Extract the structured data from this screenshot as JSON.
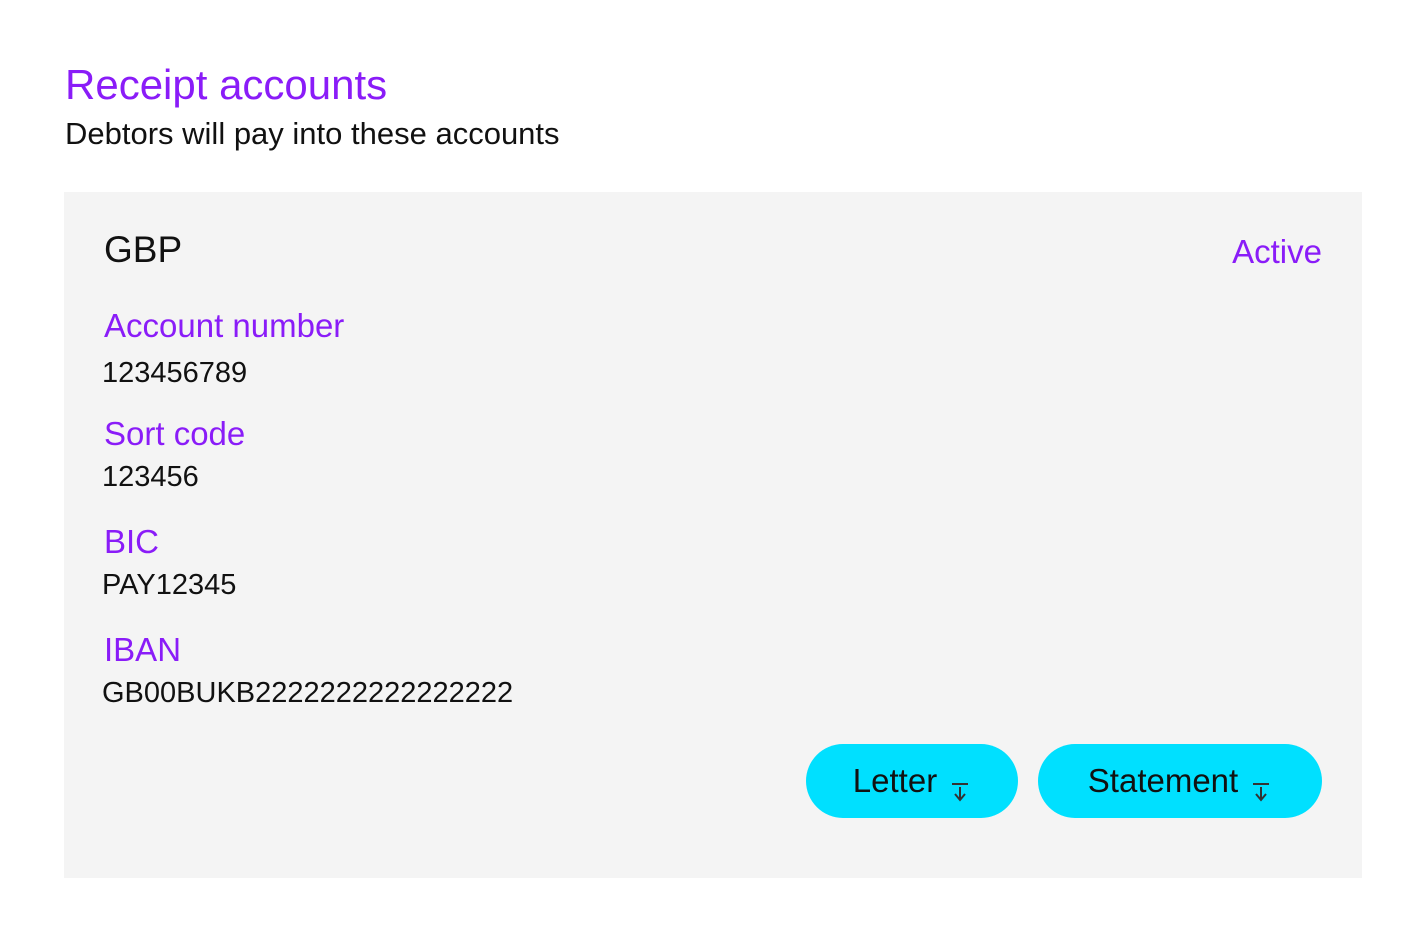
{
  "header": {
    "title": "Receipt accounts",
    "subtitle": "Debtors will pay into these accounts"
  },
  "account": {
    "currency": "GBP",
    "status": "Active",
    "fields": [
      {
        "label": "Account number",
        "value": "123456789"
      },
      {
        "label": "Sort code",
        "value": "123456"
      },
      {
        "label": "BIC",
        "value": "PAY12345"
      },
      {
        "label": "IBAN",
        "value": "GB00BUKB2222222222222222"
      }
    ],
    "actions": {
      "letter_label": "Letter",
      "statement_label": "Statement",
      "icon": "download-icon"
    }
  },
  "colors": {
    "accent": "#8a1cf8",
    "button": "#00e0ff",
    "card_background": "#f4f4f4",
    "text": "#111111"
  }
}
